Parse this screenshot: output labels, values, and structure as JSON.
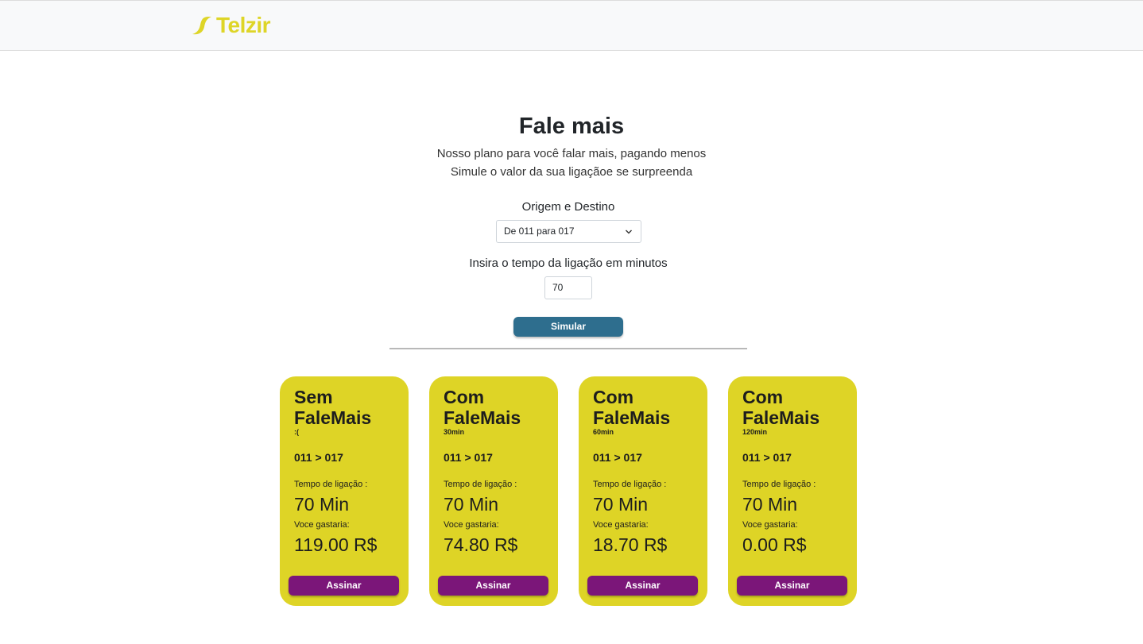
{
  "brand": {
    "name": "Telzir",
    "icon": "telzir-logo-icon",
    "color": "#ded527"
  },
  "hero": {
    "title": "Fale mais",
    "line1": "Nosso plano para você falar mais, pagando menos",
    "line2": "Simule o valor da sua ligaçãoe se surpreenda"
  },
  "form": {
    "origin_label": "Origem e Destino",
    "origin_value": "De 011 para 017",
    "minutes_label": "Insira o tempo da ligação em minutos",
    "minutes_value": "70",
    "submit_label": "Simular",
    "submit_color": "#2e6e8e"
  },
  "plans": [
    {
      "title": "Sem FaleMais",
      "subtitle": ":(",
      "route": "011 > 017",
      "time_label": "Tempo de ligação :",
      "time": "70 Min",
      "cost_label": "Voce gastaria:",
      "cost": "119.00 R$",
      "button": "Assinar"
    },
    {
      "title": "Com FaleMais",
      "subtitle": "30min",
      "route": "011 > 017",
      "time_label": "Tempo de ligação :",
      "time": "70 Min",
      "cost_label": "Voce gastaria:",
      "cost": "74.80 R$",
      "button": "Assinar"
    },
    {
      "title": "Com FaleMais",
      "subtitle": "60min",
      "route": "011 > 017",
      "time_label": "Tempo de ligação :",
      "time": "70 Min",
      "cost_label": "Voce gastaria:",
      "cost": "18.70 R$",
      "button": "Assinar"
    },
    {
      "title": "Com FaleMais",
      "subtitle": "120min",
      "route": "011 > 017",
      "time_label": "Tempo de ligação :",
      "time": "70 Min",
      "cost_label": "Voce gastaria:",
      "cost": "0.00 R$",
      "button": "Assinar"
    }
  ],
  "colors": {
    "card": "#ded426",
    "card_button": "#7b1679"
  }
}
